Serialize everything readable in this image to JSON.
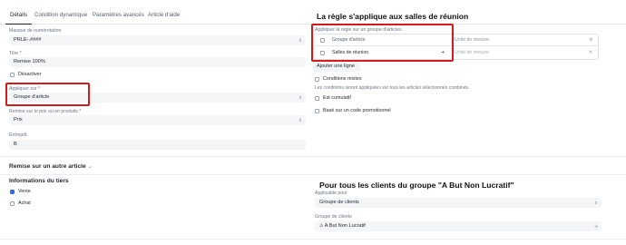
{
  "tabs": [
    {
      "label": "Détails"
    },
    {
      "label": "Condition dynamique"
    },
    {
      "label": "Paramètres avancés"
    },
    {
      "label": "Article d'aide"
    }
  ],
  "left": {
    "masque_label": "Masque de numérotation",
    "masque_value": "PRLE-.####",
    "titre_label": "Titre",
    "titre_value": "Remise 100%",
    "desactiver_label": "Désactiver",
    "appliquer_sur_label": "Appliquer sur",
    "appliquer_sur_value": "Groupe d'article",
    "remise_prix_label": "Remise sur le prix ou en produits",
    "remise_prix_value": "Prix",
    "entrepot_label": "Entrepôt",
    "entrepot_value": "B",
    "required_mark": "*"
  },
  "right": {
    "annotation_top": "La règle s'applique aux salles de réunion",
    "appliquer_regle_label": "Appliquer la règle sur un groupe d'articles",
    "table_header_groupe": "Groupe d'article",
    "table_header_unite": "Unité de mesure",
    "row_groupe": "Salles de réunion",
    "row_unite": "Unité de mesure",
    "ajouter_ligne": "Ajouter une ligne",
    "conditions_mixtes_label": "Conditions mixtes",
    "conditions_mixtes_help": "Les conditions seront appliquées sur tous les articles sélectionnés combinés.",
    "est_cumulatif_label": "Est cumulatif",
    "code_promo_label": "Basé sur un code promotionnel"
  },
  "remise_autre_article": "Remise sur un autre article",
  "tiers": {
    "title": "Informations du tiers",
    "vente_label": "Vente",
    "achat_label": "Achat",
    "annotation": "Pour tous les clients du groupe \"A But Non Lucratif\"",
    "applicable_pour_label": "Applicable pour",
    "applicable_pour_value": "Groupe de clients",
    "groupe_clients_label": "Groupe de clients",
    "groupe_clients_value": "A But Non Lucratif"
  },
  "state": {
    "vente_checked": true,
    "achat_checked": false,
    "desactiver_checked": false
  },
  "colors": {
    "accent": "#2f6fdd",
    "annotation_box": "#d01c1c"
  }
}
